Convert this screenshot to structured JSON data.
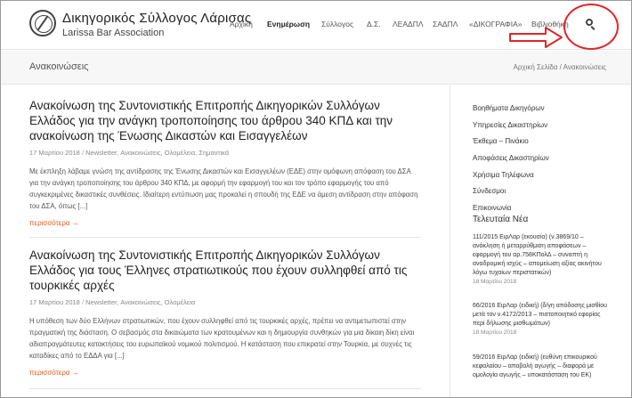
{
  "site": {
    "title": "Δικηγορικός Σύλλογος Λάρισας",
    "subtitle": "Larissa Bar Association"
  },
  "nav": {
    "items": [
      {
        "label": "Αρχική"
      },
      {
        "label": "Ενημέρωση"
      },
      {
        "label": "Σύλλογος"
      },
      {
        "label": "Δ.Σ."
      },
      {
        "label": "ΛΕΑΔΠΛ"
      },
      {
        "label": "ΣΑΔΠΛ"
      },
      {
        "label": "«ΔΙΚΟΓΡΑΦΙΑ»"
      },
      {
        "label": "Βιβλιοθήκη"
      }
    ],
    "search_icon": "search-icon"
  },
  "titlebar": {
    "page_title": "Ανακοινώσεις",
    "breadcrumb_home": "Αρχική Σελίδα",
    "breadcrumb_sep": "/",
    "breadcrumb_current": "Ανακοινώσεις"
  },
  "posts": [
    {
      "title": "Ανακοίνωση της Συντονιστικής Επιτροπής Δικηγορικών Συλλόγων Ελλάδος για την ανάγκη τροποποίησης του άρθρου 340 ΚΠΔ και την ανακοίνωση της Ένωσης Δικαστών και Εισαγγελέων",
      "date": "17 Μαρτίου 2018",
      "categories": "Newsletter, Ανακοινώσεις, Ολομέλεια, Σημαντικά",
      "excerpt": "Με έκπληξη λάβαμε γνώση της αντίδρασης της Ένωσης Δικαστών και Εισαγγελέων (ΕΔΕ) στην ομόφωνη απόφαση του ΔΣΑ για την ανάγκη τροποποίησης του άρθρου 340 ΚΠΔ, με αφορμή την εφαρμογή του και τον τρόπο εφαρμογής του από συγκεκριμένες δικαστικές συνθέσεις. Ιδιαίτερη εντύπωση μας προκαλεί η σπουδή της ΕΔΕ να άμεση αντίδραση στην απόφαση του ΔΣΑ, όπως [...]",
      "read_more": "περισσότερα →"
    },
    {
      "title": "Ανακοίνωση της Συντονιστικής Επιτροπής Δικηγορικών Συλλόγων Ελλάδος για τους Έλληνες στρατιωτικούς που έχουν συλληφθεί από τις τουρκικές αρχές",
      "date": "17 Μαρτίου 2018",
      "categories": "Newsletter, Ανακοινώσεις, Ολομέλεια",
      "excerpt": "Η υπόθεση των δύο Ελλήνων στρατιωτικών, που έχουν συλληφθεί από τις τουρκικές αρχές, πρέπει να αντιμετωπιστεί στην πραγματική της διάσταση. Ο σεβασμός στα δικαιώματα των κρατουμένων και η δημιουργία συνθηκών για μια δίκαιη δίκη είναι αδιαπραγμάτευτες κατακτήσεις του ευρωπαϊκού νομικού πολιτισμού. Η κατάσταση που επικρατεί στην Τουρκία, με συχνές τις καταδίκες από το ΕΔΔΑ για [...]",
      "read_more": "περισσότερα →"
    }
  ],
  "sidebar": {
    "menu": [
      {
        "label": "Βοηθήματα Δικηγόρων"
      },
      {
        "label": "Υπηρεσίες Δικαστηρίων"
      },
      {
        "label": "Έκθεμα – Πινάκιο"
      },
      {
        "label": "Αποφάσεις Δικαστηρίων"
      },
      {
        "label": "Χρήσιμα Τηλέφωνα"
      },
      {
        "label": "Σύνδεσμοι"
      },
      {
        "label": "Επικοινωνία"
      }
    ],
    "recent_heading": "Τελευταία Νέα",
    "recent": [
      {
        "title": "111/2015 ΕιρΛαρ (εκουσία) (ν.3869/10 – ανάκληση ή μεταρρύθμιση αποφάσεων – εφαρμογή του αρ.758ΚΠολΔ – συναπτή η αναδρομική ισχύς – απομείωση αξίας ακινήτου λόγω τυχαίων περιστατικών)",
        "date": "18 Μαρτίου 2018"
      },
      {
        "title": "66/2016 ΕιρΛαρ (ειδική) (δ/γη απόδοσης μισθίου μετά τον ν.4172/2013 – πιστοποιητικό εφορίας περί δήλωσης μισθωμάτων)",
        "date": "18 Μαρτίου 2018"
      },
      {
        "title": "59/2016 ΕιρΛαρ (ειδική) (ευθύνη επικουρικού κεφαλαίου – αποβολή αγωγής – διαφορά με ομολογία αγωγής – υποκατάσταση του ΕΚ)",
        "date": ""
      }
    ]
  },
  "colors": {
    "accent": "#e05a1f",
    "annotation": "#e0252a"
  }
}
